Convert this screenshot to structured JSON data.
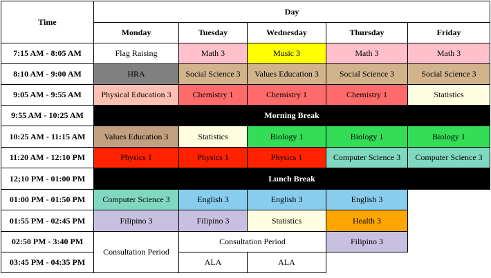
{
  "header": {
    "time": "Time",
    "day": "Day"
  },
  "days": [
    "Monday",
    "Tuesday",
    "Wednesday",
    "Thursday",
    "Friday"
  ],
  "colors": {
    "pink": "#ffc0cb",
    "yellow": "#ffff00",
    "tan": "#d2b48c",
    "gray": "#808080",
    "salmon": "#ffc0b4",
    "red": "#ff6a6a",
    "cream": "#fffee0",
    "brown": "#c0a080",
    "green": "#33dd55",
    "bright_red": "#ff2200",
    "teal": "#80d8c0",
    "sky": "#88ccee",
    "lavender": "#c8c0e0",
    "orange": "#ffa500",
    "black": "#000000"
  },
  "rows": {
    "r1": {
      "time": "7:15 AM - 8:05 AM",
      "mon": "Flag Raising",
      "tue": "Math 3",
      "wed": "Music 3",
      "thu": "Math 3",
      "fri": "Math 3"
    },
    "r2": {
      "time": "8:10 AM - 9:00 AM",
      "mon": "HRA",
      "tue": "Social Science 3",
      "wed": "Values Education 3",
      "thu": "Social Science 3",
      "fri": "Social Science 3"
    },
    "r3": {
      "time": "9:05 AM - 9:55 AM",
      "mon": "Physical Education 3",
      "tue": "Chemistry 1",
      "wed": "Chemistry 1",
      "thu": "Chemistry 1",
      "fri": "Statistics"
    },
    "r4": {
      "time": "9:55 AM - 10:25 AM",
      "break": "Morning Break"
    },
    "r5": {
      "time": "10:25 AM - 11:15 AM",
      "mon": "Values Education 3",
      "tue": "Statistics",
      "wed": "Biology 1",
      "thu": "Biology 1",
      "fri": "Biology 1"
    },
    "r6": {
      "time": "11:20 AM - 12:10 PM",
      "mon": "Physics 1",
      "tue": "Physics 1",
      "wed": "Physics 1",
      "thu": "Computer Science 3",
      "fri": "Computer Science 3"
    },
    "r7": {
      "time": "12;10 PM - 01:00 PM",
      "break": "Lunch Break"
    },
    "r8": {
      "time": "01:00 PM - 01:50 PM",
      "mon": "Computer Science 3",
      "tue": "English 3",
      "wed": "English 3",
      "thu": "English 3"
    },
    "r9": {
      "time": "01:55 PM - 02:45 PM",
      "mon": "Filipino 3",
      "tue": "Filipino 3",
      "wed": "Statistics",
      "thu": "Health 3"
    },
    "r10": {
      "time": "02:50 PM - 3:40 PM",
      "mon": "Consultation Period",
      "tuewed": "Consultation Period",
      "thu": "Filipino 3"
    },
    "r11": {
      "time": "03:45 PM - 04:35 PM",
      "tue": "ALA",
      "wed": "ALA"
    }
  }
}
